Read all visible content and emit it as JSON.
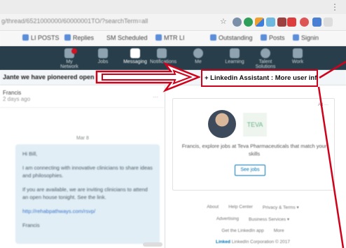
{
  "browser": {
    "menu_glyph": "⋮",
    "url": "g/thread/6521000000/60000001TO/?searchTerm=all",
    "star_glyph": "☆",
    "bookmarks": [
      {
        "label": "LI POSTS"
      },
      {
        "label": "Replies"
      },
      {
        "label": "SM Scheduled"
      },
      {
        "label": "MTR LI"
      },
      {
        "label": "Outstanding"
      },
      {
        "label": "Posts"
      },
      {
        "label": "Signin"
      }
    ]
  },
  "linkedin_nav": {
    "items": [
      {
        "label": "My Network"
      },
      {
        "label": "Jobs"
      },
      {
        "label": "Messaging"
      },
      {
        "label": "Notifications"
      },
      {
        "label": "Me"
      },
      {
        "label": "Learning"
      },
      {
        "label": "Talent Solutions"
      },
      {
        "label": "Work"
      }
    ]
  },
  "banner": {
    "text": "Jante we have pioneered open lines of..."
  },
  "messaging": {
    "contact_name": "Francis",
    "contact_sub": "2 days ago",
    "menu_dots": "···",
    "date_divider": "Mar 8",
    "paragraphs": [
      "Hi Bill,",
      "I am connecting with innovative clinicians to share ideas and philosophies.",
      "If you are available, we are inviting clinicians to attend an open house tonight. See the link.",
      "http://rehabpathways.com/rsvp/"
    ],
    "signoff": "Francis"
  },
  "job_card": {
    "ad_label": "Ad ···",
    "company_logo_text": "TEVA",
    "description": "Francis, explore jobs at Teva Pharmaceuticals that match your skills",
    "button": "See jobs"
  },
  "footer": {
    "row1": [
      "About",
      "Help Center",
      "Privacy & Terms ▾"
    ],
    "row2": [
      "Advertising",
      "Business Services ▾"
    ],
    "row3": [
      "Get the LinkedIn app",
      "More"
    ],
    "brand": "Linked",
    "copyright": "LinkedIn Corporation © 2017"
  },
  "annotation": {
    "label": "+ Linkedin Assistant : More user info...",
    "color": "#d0021b"
  }
}
